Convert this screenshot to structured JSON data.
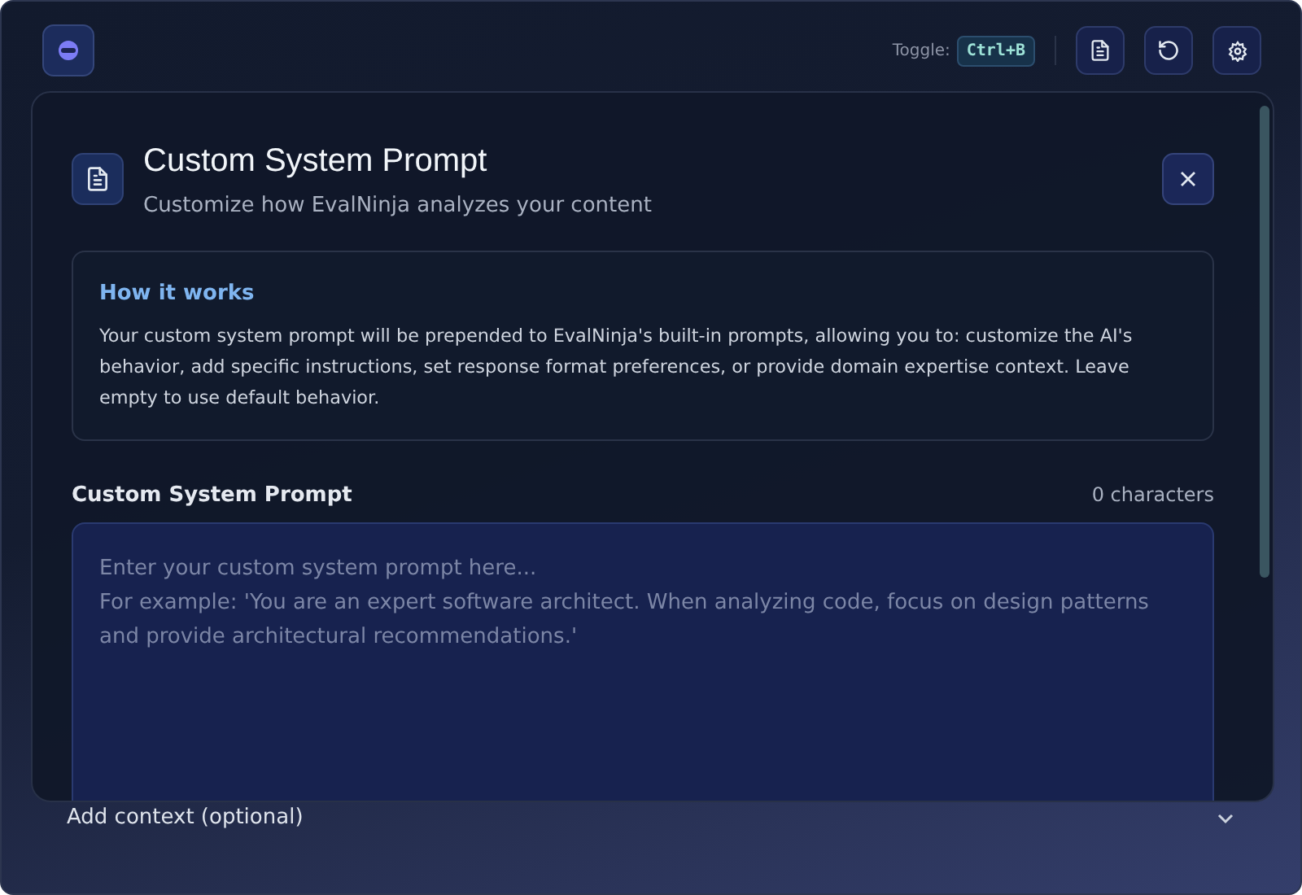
{
  "top_bar": {
    "toggle_label": "Toggle:",
    "shortcut": "Ctrl+B"
  },
  "modal": {
    "title": "Custom System Prompt",
    "subtitle": "Customize how EvalNinja analyzes your content",
    "info": {
      "title": "How it works",
      "text": "Your custom system prompt will be prepended to EvalNinja's built-in prompts, allowing you to: customize the AI's behavior, add specific instructions, set response format preferences, or provide domain expertise context. Leave empty to use default behavior."
    },
    "field": {
      "label": "Custom System Prompt",
      "count": "0 characters",
      "placeholder": "Enter your custom system prompt here...\nFor example: 'You are an expert software architect. When analyzing code, focus on design patterns and provide architectural recommendations.'"
    }
  },
  "context_section": {
    "label": "Add context (optional)",
    "expanded": false
  }
}
